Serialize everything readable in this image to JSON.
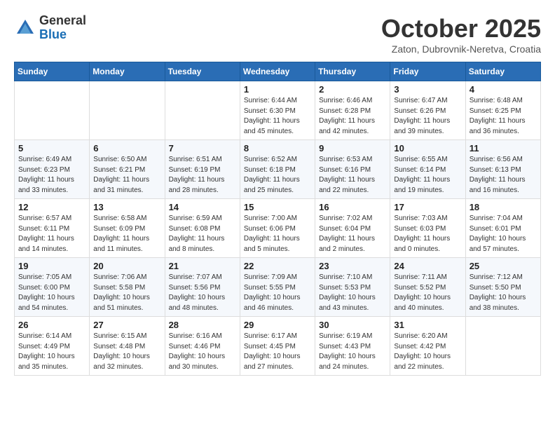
{
  "header": {
    "logo_general": "General",
    "logo_blue": "Blue",
    "month": "October 2025",
    "location": "Zaton, Dubrovnik-Neretva, Croatia"
  },
  "days_of_week": [
    "Sunday",
    "Monday",
    "Tuesday",
    "Wednesday",
    "Thursday",
    "Friday",
    "Saturday"
  ],
  "weeks": [
    [
      {
        "day": "",
        "info": ""
      },
      {
        "day": "",
        "info": ""
      },
      {
        "day": "",
        "info": ""
      },
      {
        "day": "1",
        "info": "Sunrise: 6:44 AM\nSunset: 6:30 PM\nDaylight: 11 hours\nand 45 minutes."
      },
      {
        "day": "2",
        "info": "Sunrise: 6:46 AM\nSunset: 6:28 PM\nDaylight: 11 hours\nand 42 minutes."
      },
      {
        "day": "3",
        "info": "Sunrise: 6:47 AM\nSunset: 6:26 PM\nDaylight: 11 hours\nand 39 minutes."
      },
      {
        "day": "4",
        "info": "Sunrise: 6:48 AM\nSunset: 6:25 PM\nDaylight: 11 hours\nand 36 minutes."
      }
    ],
    [
      {
        "day": "5",
        "info": "Sunrise: 6:49 AM\nSunset: 6:23 PM\nDaylight: 11 hours\nand 33 minutes."
      },
      {
        "day": "6",
        "info": "Sunrise: 6:50 AM\nSunset: 6:21 PM\nDaylight: 11 hours\nand 31 minutes."
      },
      {
        "day": "7",
        "info": "Sunrise: 6:51 AM\nSunset: 6:19 PM\nDaylight: 11 hours\nand 28 minutes."
      },
      {
        "day": "8",
        "info": "Sunrise: 6:52 AM\nSunset: 6:18 PM\nDaylight: 11 hours\nand 25 minutes."
      },
      {
        "day": "9",
        "info": "Sunrise: 6:53 AM\nSunset: 6:16 PM\nDaylight: 11 hours\nand 22 minutes."
      },
      {
        "day": "10",
        "info": "Sunrise: 6:55 AM\nSunset: 6:14 PM\nDaylight: 11 hours\nand 19 minutes."
      },
      {
        "day": "11",
        "info": "Sunrise: 6:56 AM\nSunset: 6:13 PM\nDaylight: 11 hours\nand 16 minutes."
      }
    ],
    [
      {
        "day": "12",
        "info": "Sunrise: 6:57 AM\nSunset: 6:11 PM\nDaylight: 11 hours\nand 14 minutes."
      },
      {
        "day": "13",
        "info": "Sunrise: 6:58 AM\nSunset: 6:09 PM\nDaylight: 11 hours\nand 11 minutes."
      },
      {
        "day": "14",
        "info": "Sunrise: 6:59 AM\nSunset: 6:08 PM\nDaylight: 11 hours\nand 8 minutes."
      },
      {
        "day": "15",
        "info": "Sunrise: 7:00 AM\nSunset: 6:06 PM\nDaylight: 11 hours\nand 5 minutes."
      },
      {
        "day": "16",
        "info": "Sunrise: 7:02 AM\nSunset: 6:04 PM\nDaylight: 11 hours\nand 2 minutes."
      },
      {
        "day": "17",
        "info": "Sunrise: 7:03 AM\nSunset: 6:03 PM\nDaylight: 11 hours\nand 0 minutes."
      },
      {
        "day": "18",
        "info": "Sunrise: 7:04 AM\nSunset: 6:01 PM\nDaylight: 10 hours\nand 57 minutes."
      }
    ],
    [
      {
        "day": "19",
        "info": "Sunrise: 7:05 AM\nSunset: 6:00 PM\nDaylight: 10 hours\nand 54 minutes."
      },
      {
        "day": "20",
        "info": "Sunrise: 7:06 AM\nSunset: 5:58 PM\nDaylight: 10 hours\nand 51 minutes."
      },
      {
        "day": "21",
        "info": "Sunrise: 7:07 AM\nSunset: 5:56 PM\nDaylight: 10 hours\nand 48 minutes."
      },
      {
        "day": "22",
        "info": "Sunrise: 7:09 AM\nSunset: 5:55 PM\nDaylight: 10 hours\nand 46 minutes."
      },
      {
        "day": "23",
        "info": "Sunrise: 7:10 AM\nSunset: 5:53 PM\nDaylight: 10 hours\nand 43 minutes."
      },
      {
        "day": "24",
        "info": "Sunrise: 7:11 AM\nSunset: 5:52 PM\nDaylight: 10 hours\nand 40 minutes."
      },
      {
        "day": "25",
        "info": "Sunrise: 7:12 AM\nSunset: 5:50 PM\nDaylight: 10 hours\nand 38 minutes."
      }
    ],
    [
      {
        "day": "26",
        "info": "Sunrise: 6:14 AM\nSunset: 4:49 PM\nDaylight: 10 hours\nand 35 minutes."
      },
      {
        "day": "27",
        "info": "Sunrise: 6:15 AM\nSunset: 4:48 PM\nDaylight: 10 hours\nand 32 minutes."
      },
      {
        "day": "28",
        "info": "Sunrise: 6:16 AM\nSunset: 4:46 PM\nDaylight: 10 hours\nand 30 minutes."
      },
      {
        "day": "29",
        "info": "Sunrise: 6:17 AM\nSunset: 4:45 PM\nDaylight: 10 hours\nand 27 minutes."
      },
      {
        "day": "30",
        "info": "Sunrise: 6:19 AM\nSunset: 4:43 PM\nDaylight: 10 hours\nand 24 minutes."
      },
      {
        "day": "31",
        "info": "Sunrise: 6:20 AM\nSunset: 4:42 PM\nDaylight: 10 hours\nand 22 minutes."
      },
      {
        "day": "",
        "info": ""
      }
    ]
  ]
}
